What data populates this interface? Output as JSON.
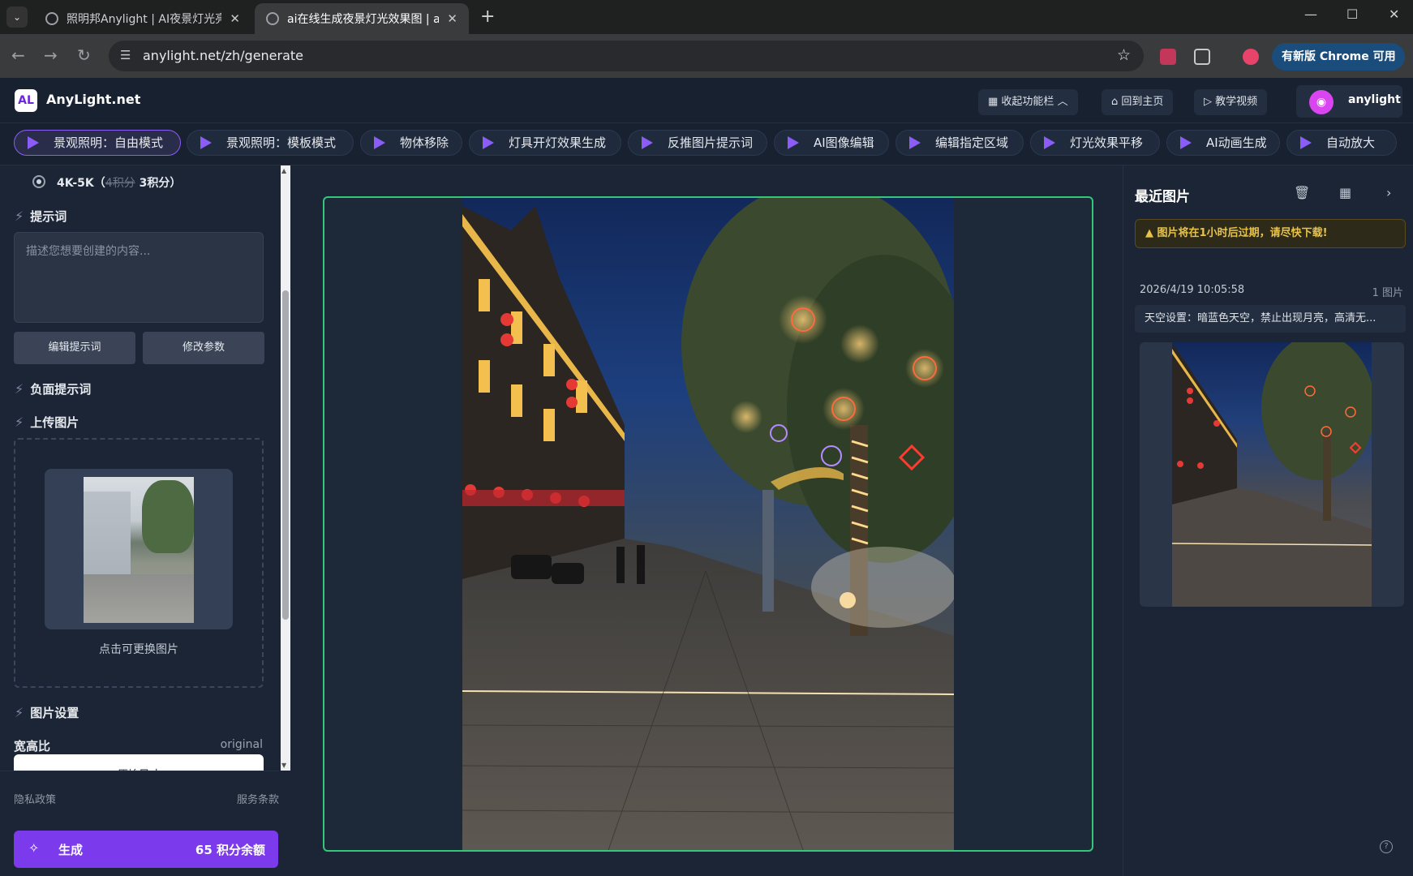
{
  "browser": {
    "tabs": [
      {
        "title": "照明邦Anylight | AI夜景灯光亮",
        "active": false
      },
      {
        "title": "ai在线生成夜景灯光效果图 | ai",
        "active": true
      }
    ],
    "url": "anylight.net/zh/generate",
    "update_label": "有新版 Chrome 可用"
  },
  "app": {
    "brand": "AnyLight.net",
    "logo_text": "AL",
    "header_buttons": {
      "collapse": "收起功能栏",
      "home": "回到主页",
      "tutorial": "教学视频"
    },
    "user": {
      "name": "anylight"
    }
  },
  "modes": [
    {
      "label": "景观照明：自由模式",
      "active": true
    },
    {
      "label": "景观照明：模板模式",
      "active": false
    },
    {
      "label": "物体移除",
      "active": false
    },
    {
      "label": "灯具开灯效果生成",
      "active": false
    },
    {
      "label": "反推图片提示词",
      "active": false
    },
    {
      "label": "AI图像编辑",
      "active": false
    },
    {
      "label": "编辑指定区域",
      "active": false
    },
    {
      "label": "灯光效果平移",
      "active": false
    },
    {
      "label": "AI动画生成",
      "active": false
    },
    {
      "label": "自动放大",
      "active": false
    }
  ],
  "sidebar": {
    "resolution": {
      "label": "4K-5K（",
      "old_price": "4积分",
      "price": "3积分）"
    },
    "prompt_title": "提示词",
    "prompt_placeholder": "描述您想要创建的内容...",
    "edit_prompt": "编辑提示词",
    "modify_params": "修改参数",
    "negative_title": "负面提示词",
    "upload_title": "上传图片",
    "upload_caption": "点击可更换图片",
    "image_settings_title": "图片设置",
    "aspect_label": "宽高比",
    "aspect_value": "original",
    "aspect_select": "原始尺寸",
    "privacy": "隐私政策",
    "terms": "服务条款",
    "generate": "生成",
    "balance": "65 积分余额"
  },
  "right_panel": {
    "title": "最近图片",
    "warning": "图片将在1小时后过期，请尽快下载!",
    "timestamp": "2026/4/19 10:05:58",
    "count": "1 图片",
    "description": "天空设置：暗蓝色天空，禁止出现月亮，高清无..."
  },
  "colors": {
    "accent": "#7c3aed",
    "frame_border": "#34c77b",
    "background": "#1b2535"
  }
}
